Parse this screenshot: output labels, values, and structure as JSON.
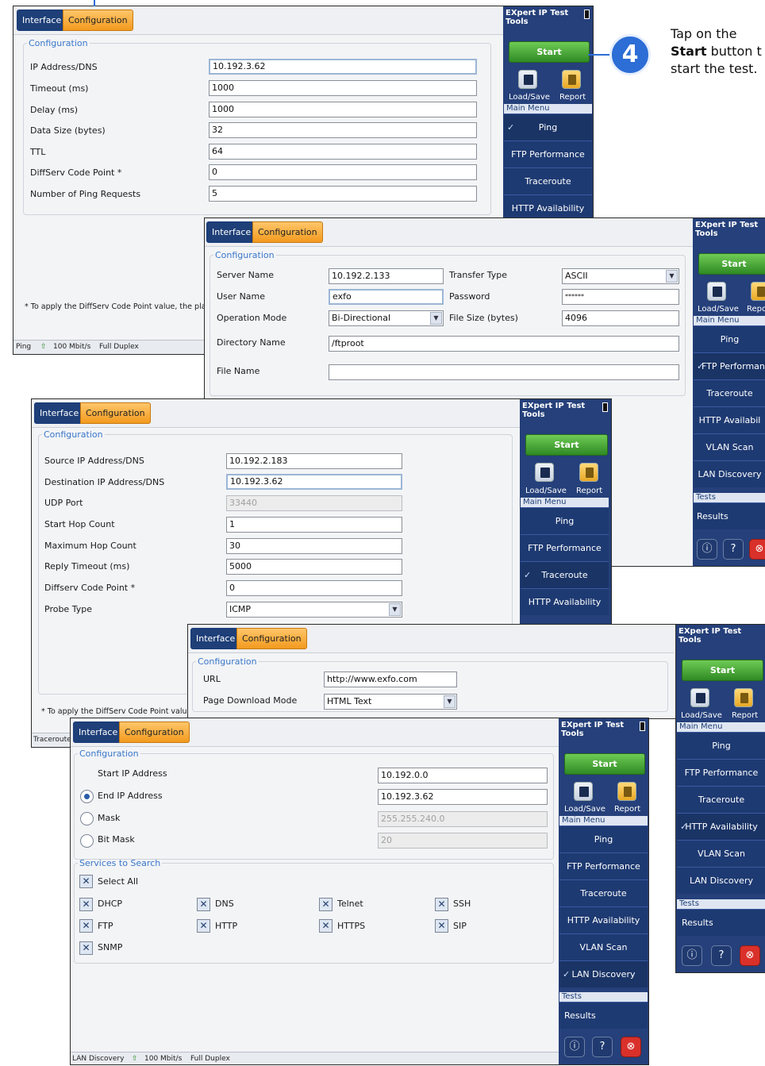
{
  "callout": {
    "number": "4",
    "line1": "Tap on the",
    "bold": "Start",
    "line2_rest": " button t",
    "line3": "start the test."
  },
  "common": {
    "tab_interface": "Interface",
    "tab_configuration": "Configuration",
    "side_title_1": "EXpert IP Test",
    "side_title_2": "Tools",
    "start": "Start",
    "load_save": "Load/Save",
    "report": "Report",
    "main_menu": "Main Menu",
    "tests": "Tests",
    "results": "Results",
    "speed": "100 Mbit/s",
    "duplex": "Full Duplex"
  },
  "menu": {
    "ping": "Ping",
    "ftp": "FTP Performance",
    "traceroute": "Traceroute",
    "http": "HTTP Availability",
    "vlan": "VLAN Scan",
    "lan": "LAN Discovery"
  },
  "ping": {
    "legend": "Configuration",
    "fields": [
      {
        "label": "IP Address/DNS",
        "value": "10.192.3.62"
      },
      {
        "label": "Timeout (ms)",
        "value": "1000"
      },
      {
        "label": "Delay (ms)",
        "value": "1000"
      },
      {
        "label": "Data Size (bytes)",
        "value": "32"
      },
      {
        "label": "TTL",
        "value": "64"
      },
      {
        "label": "DiffServ Code Point *",
        "value": "0"
      },
      {
        "label": "Number of Ping Requests",
        "value": "5"
      }
    ],
    "note": "* To apply the DiffServ Code Point value, the platf",
    "status_test": "Ping"
  },
  "ftp": {
    "legend": "Configuration",
    "server_label": "Server Name",
    "server_value": "10.192.2.133",
    "transfer_label": "Transfer Type",
    "transfer_value": "ASCII",
    "user_label": "User Name",
    "user_value": "exfo",
    "password_label": "Password",
    "password_value": "******",
    "mode_label": "Operation Mode",
    "mode_value": "Bi-Directional",
    "filesize_label": "File Size (bytes)",
    "filesize_value": "4096",
    "dir_label": "Directory Name",
    "dir_value": "/ftproot",
    "file_label": "File Name",
    "file_value": "",
    "menu_ftp_short": "FTP Performan",
    "menu_http_short": "HTTP Availabil",
    "load_save_short": "Load/Save",
    "report_short": "Repo"
  },
  "trace": {
    "legend": "Configuration",
    "fields": [
      {
        "label": "Source IP Address/DNS",
        "value": "10.192.2.183"
      },
      {
        "label": "Destination IP Address/DNS",
        "value": "10.192.3.62"
      },
      {
        "label": "UDP Port",
        "value": "33440"
      },
      {
        "label": "Start Hop Count",
        "value": "1"
      },
      {
        "label": "Maximum Hop Count",
        "value": "30"
      },
      {
        "label": "Reply Timeout (ms)",
        "value": "5000"
      },
      {
        "label": "Diffserv Code Point *",
        "value": "0"
      },
      {
        "label": "Probe Type",
        "value": "ICMP"
      }
    ],
    "note": "* To apply the DiffServ Code Point value",
    "status_test": "Traceroute"
  },
  "http": {
    "legend": "Configuration",
    "url_label": "URL",
    "url_value": "http://www.exfo.com",
    "mode_label": "Page Download Mode",
    "mode_value": "HTML Text"
  },
  "lan": {
    "legend": "Configuration",
    "start_label": "Start IP Address",
    "start_value": "10.192.0.0",
    "end_label": "End IP Address",
    "end_value": "10.192.3.62",
    "mask_label": "Mask",
    "mask_value": "255.255.240.0",
    "bitmask_label": "Bit Mask",
    "bitmask_value": "20",
    "services_legend": "Services to Search",
    "select_all": "Select All",
    "services": [
      "DHCP",
      "DNS",
      "Telnet",
      "SSH",
      "FTP",
      "HTTP",
      "HTTPS",
      "SIP",
      "SNMP"
    ],
    "status_test": "LAN Discovery"
  }
}
